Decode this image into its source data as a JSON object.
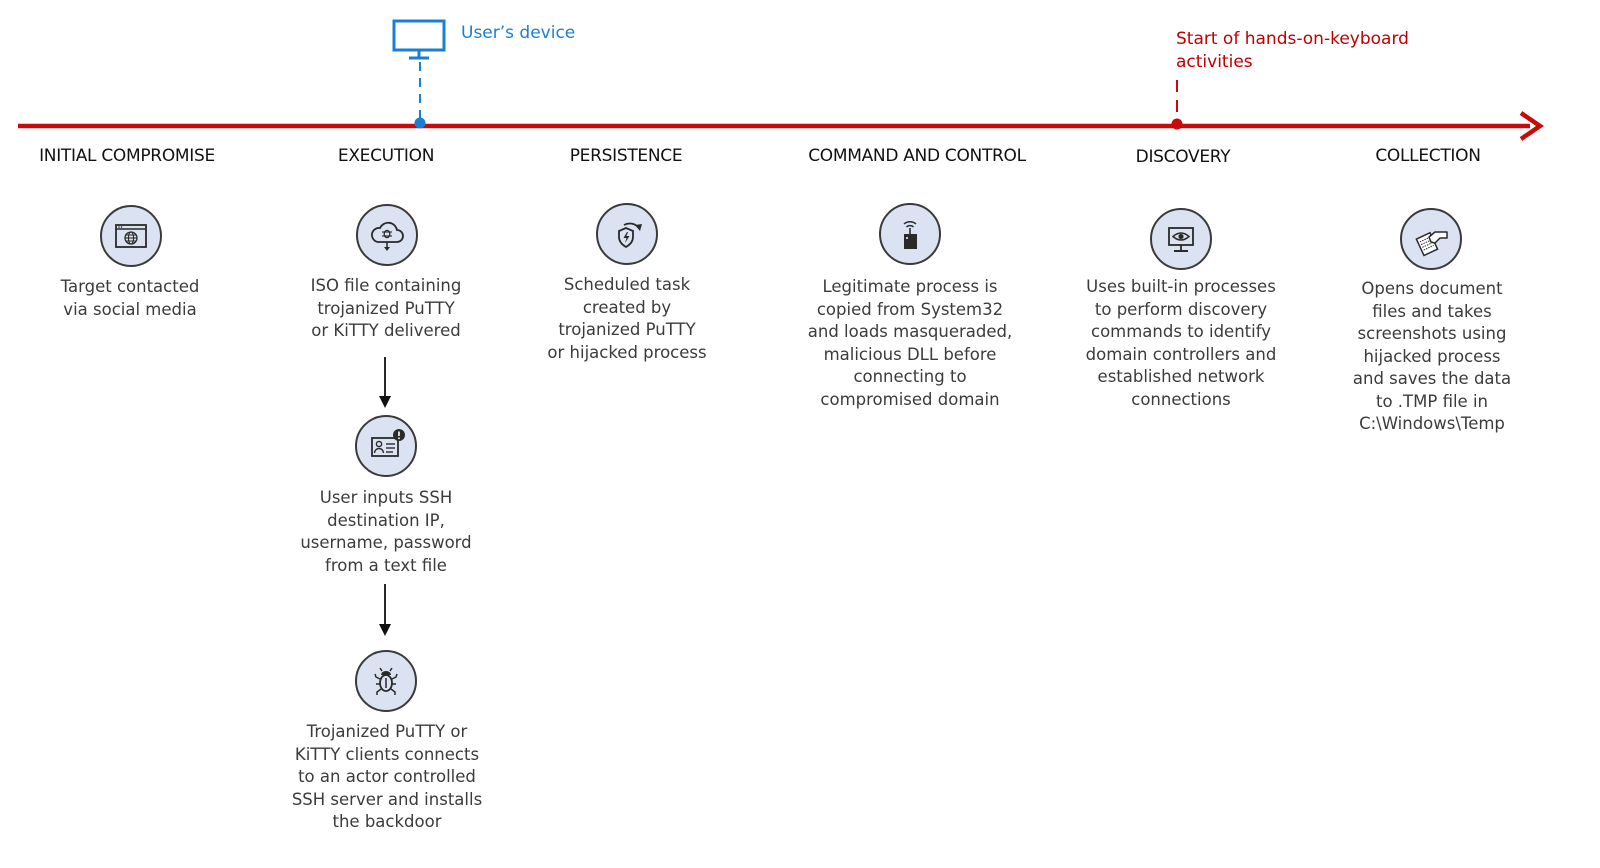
{
  "colors": {
    "timeline": "#c80a0a",
    "user_device": "#1a7fd4",
    "icon_fill": "#dbe3f3",
    "icon_stroke": "#3a3a3a",
    "heading_text": "#111111",
    "body_text": "#3b3b3b"
  },
  "markers": {
    "user_device": {
      "label": "User’s device",
      "icon": "monitor-icon"
    },
    "hands_on_keyboard": {
      "label": "Start of hands-on-keyboard\nactivities"
    }
  },
  "stages": [
    {
      "title": "INITIAL COMPROMISE",
      "steps": [
        {
          "icon": "browser-globe-icon",
          "text": "Target contacted\nvia social media"
        }
      ]
    },
    {
      "title": "EXECUTION",
      "steps": [
        {
          "icon": "cloud-download-bug-icon",
          "text": "ISO file containing\ntrojanized PuTTY\nor KiTTY delivered"
        },
        {
          "icon": "id-card-alert-icon",
          "text": "User inputs SSH\ndestination IP,\nusername, password\nfrom a text file"
        },
        {
          "icon": "bug-icon",
          "text": "Trojanized PuTTY or\nKiTTY clients connects\nto an actor controlled\nSSH server and installs\nthe backdoor"
        }
      ]
    },
    {
      "title": "PERSISTENCE",
      "steps": [
        {
          "icon": "shield-refresh-icon",
          "text": "Scheduled task\ncreated by\ntrojanized PuTTY\nor hijacked process"
        }
      ]
    },
    {
      "title": "COMMAND AND CONTROL",
      "steps": [
        {
          "icon": "remote-signal-icon",
          "text": "Legitimate process is\ncopied from System32\nand loads masqueraded,\nmalicious DLL before\nconnecting to\ncompromised domain"
        }
      ]
    },
    {
      "title": "DISCOVERY",
      "steps": [
        {
          "icon": "monitor-eye-icon",
          "text": "Uses built-in processes\nto perform discovery\ncommands to identify\ndomain controllers and\nestablished network\nconnections"
        }
      ]
    },
    {
      "title": "COLLECTION",
      "steps": [
        {
          "icon": "hand-document-icon",
          "text": "Opens document\nfiles and takes\nscreenshots using\nhijacked process\nand saves the data\nto .TMP file in\nC:\\Windows\\Temp"
        }
      ]
    }
  ]
}
